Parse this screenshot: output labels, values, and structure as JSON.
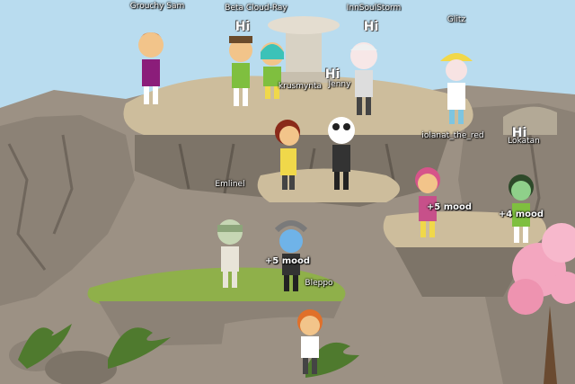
{
  "scene": {
    "type": "multiplayer-avatar-hangout",
    "sky_color": "#b9dcef",
    "rock_color": "#8e8578",
    "grass_color": "#8fb04a",
    "blossom_color": "#f3a6bf"
  },
  "players": [
    {
      "name": "Grouchy Sam",
      "shirt": "#8b1d7a",
      "hair": "#e07a2a"
    },
    {
      "name": "Beta Cloud-Ray",
      "shirt": "#7fbf3f",
      "hair": "#6b4b2b",
      "bubble": "Hi"
    },
    {
      "name": "InnSoulStorm",
      "shirt": "#dddddd",
      "hair": "#f0f0f0",
      "bubble": "Hi"
    },
    {
      "name": "Glitz",
      "shirt": "#ffffff",
      "hair": "#f2d84a"
    },
    {
      "name": "krusmynta",
      "shirt": "#7fbf3f",
      "hair": "#3cc2b8"
    },
    {
      "name": "Jenny",
      "shirt": "#f0d84a",
      "hair": "#8a2a1a"
    },
    {
      "name": "iolanat_the_red",
      "shirt": "#ffffff",
      "hair": "#222222"
    },
    {
      "name": "",
      "shirt": "#c7508a",
      "hair": "#d6548a",
      "mood": "+5 mood"
    },
    {
      "name": "",
      "shirt": "#7fbf3f",
      "hair": "#2e4a2a",
      "bubble": "Hi",
      "mood": "+4 mood"
    },
    {
      "name": "Emlinel",
      "shirt": "#e8e4d8",
      "hair": "#8ca57a"
    },
    {
      "name": "Bleppo",
      "shirt": "#333333",
      "hair": "#7a7a7a",
      "mood": "+5 mood"
    },
    {
      "name": "",
      "shirt": "#ffffff",
      "hair": "#e0702a"
    }
  ],
  "hud": {
    "bubble_glizt": "Hi",
    "tag_far": "Lokatan"
  }
}
